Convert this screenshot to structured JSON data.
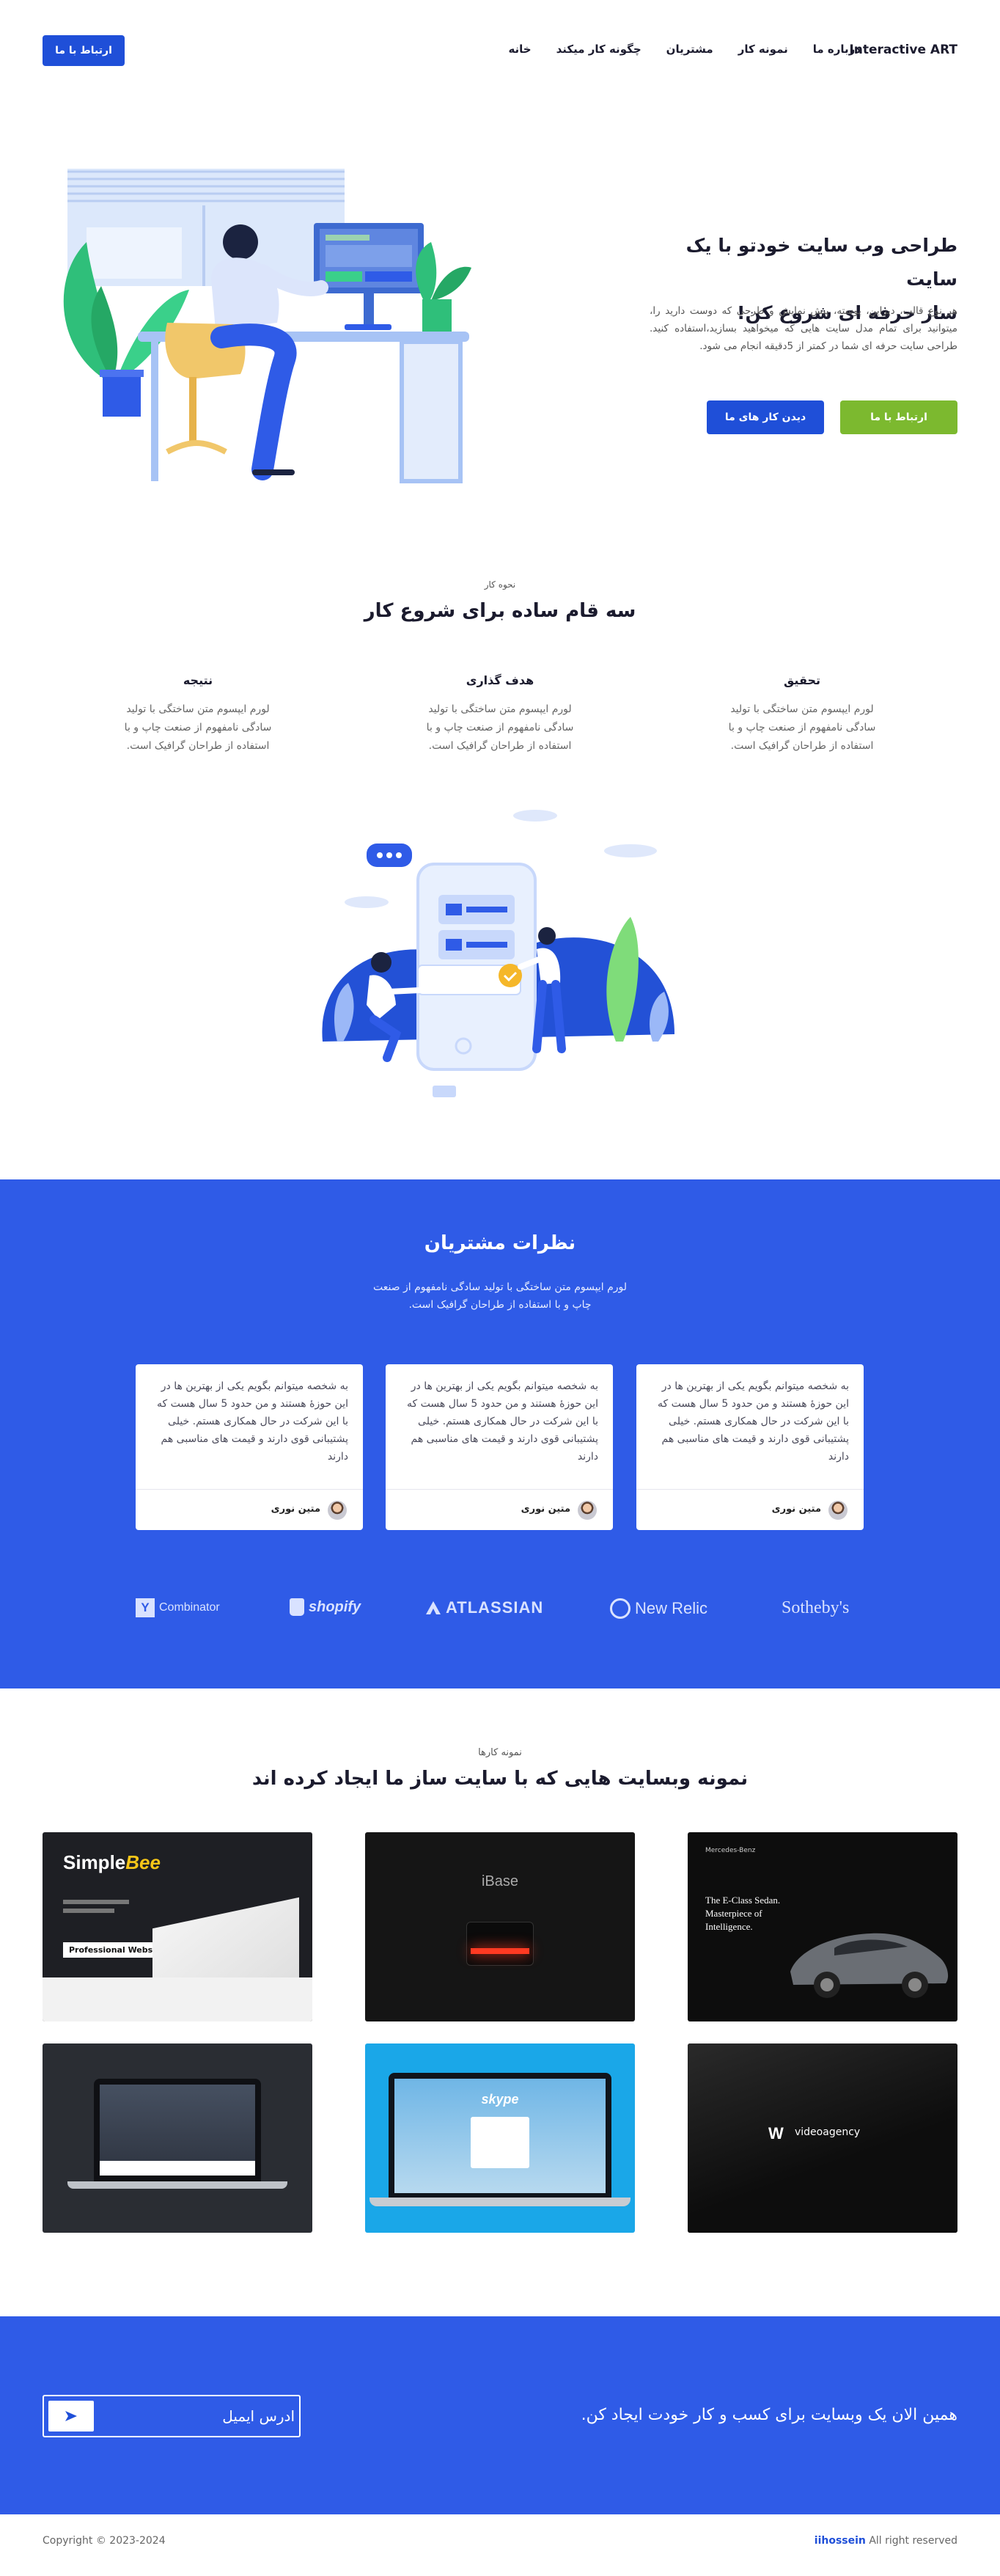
{
  "header": {
    "brand": "Interactive ART",
    "nav": [
      "خانه",
      "چگونه کار میکند",
      "مشتریان",
      "نمونه کار",
      "درباره ما"
    ],
    "contact_button": "ارتباط با ما"
  },
  "hero": {
    "title_line1": "طراحی وب سایت خودتو با یک سایت",
    "title_line2": "ساز حرفه ای شروع کن!",
    "text": "هر نوع قالب، دیزاین، پوسته، پیش نمایش و طرحی که دوست دارید را، میتوانید برای تمام مدل سایت هایی که میخواهید بسازید،استفاده کنید. طراحی سایت حرفه ای شما در کمتر از 5دقیقه انجام می شود.",
    "primary_button": "ارتباط با ما",
    "secondary_button": "دیدن کار های ما"
  },
  "steps": {
    "eyebrow": "نحوه کار",
    "title": "سه قام ساده برای شروع کار",
    "items": [
      {
        "title": "تحقیق",
        "text": "لورم ایپسوم متن ساختگی با تولید سادگی نامفهوم از صنعت چاپ و با استفاده از طراحان گرافیک است."
      },
      {
        "title": "هدف گذاری",
        "text": "لورم ایپسوم متن ساختگی با تولید سادگی نامفهوم از صنعت چاپ و با استفاده از طراحان گرافیک است."
      },
      {
        "title": "نتیجه",
        "text": "لورم ایپسوم متن ساختگی با تولید سادگی نامفهوم از صنعت چاپ و با استفاده از طراحان گرافیک است."
      }
    ]
  },
  "testimonials": {
    "title": "نظرات مشتریان",
    "subtitle_line1": "لورم ایپسوم متن ساختگی با تولید سادگی نامفهوم از صنعت",
    "subtitle_line2": "چاپ و با استفاده از طراحان گرافیک است.",
    "cards": [
      {
        "text": "به شخصه میتوانم بگویم یکی از بهترین ها در این حوزهٔ هستند و من حدود 5 سال هست که با این شرکت در حال همکاری هستم. خیلی پشتیبانی قوی دارند و قیمت های مناسبی هم دارند",
        "name": "متین نوری"
      },
      {
        "text": "به شخصه میتوانم بگویم یکی از بهترین ها در این حوزهٔ هستند و من حدود 5 سال هست که با این شرکت در حال همکاری هستم. خیلی پشتیبانی قوی دارند و قیمت های مناسبی هم دارند",
        "name": "متین نوری"
      },
      {
        "text": "به شخصه میتوانم بگویم یکی از بهترین ها در این حوزهٔ هستند و من حدود 5 سال هست که با این شرکت در حال همکاری هستم. خیلی پشتیبانی قوی دارند و قیمت های مناسبی هم دارند",
        "name": "متین نوری"
      }
    ],
    "logos": {
      "combinator_mark": "Y",
      "combinator": "Combinator",
      "shopify": "shopify",
      "atlassian": "ATLASSIAN",
      "newrelic": "New Relic",
      "sothebys": "Sotheby's"
    }
  },
  "portfolio": {
    "eyebrow": "نمونه کارها",
    "title": "نمونه وبسایت هایی که با سایت ساز ما ایجاد کرده اند",
    "items": [
      {
        "name": "SimpleBee",
        "tagline": "Professional Website",
        "tag": "Simple"
      },
      {
        "name": "iBase"
      },
      {
        "name": "The E-Class Sedan. Masterpiece of Intelligence.",
        "brand": "Mercedes-Benz"
      },
      {
        "name": "laptop"
      },
      {
        "name": "skype"
      },
      {
        "name": "videoagency"
      }
    ]
  },
  "cta": {
    "text": "همین الان یک وبسایت برای کسب و کار خودت ایجاد کن.",
    "email_placeholder": "ادرس ایمیل"
  },
  "footer": {
    "copyright": "Copyright © 2023-2024",
    "rights_author": "iihossein",
    "rights_text": "All right reserved"
  },
  "colors": {
    "primary": "#1f4fd8",
    "section_blue": "#2f5be7",
    "green": "#7cb92f"
  }
}
